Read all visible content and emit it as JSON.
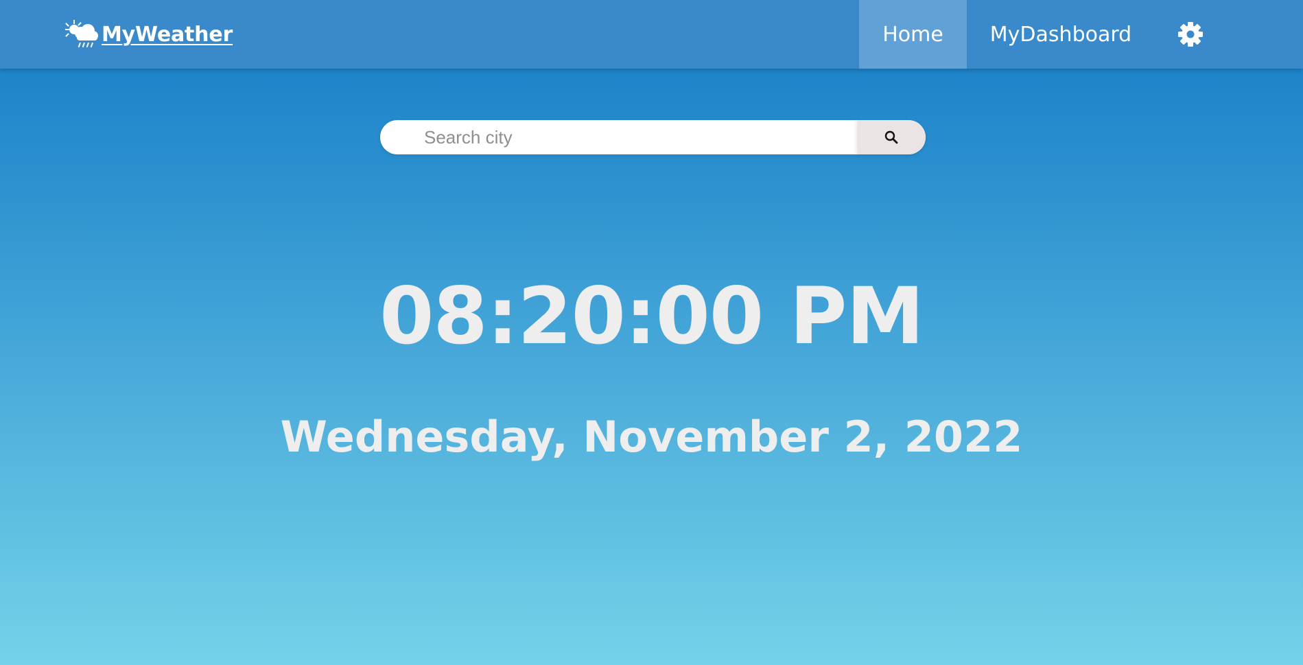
{
  "header": {
    "brand_name": "MyWeather",
    "brand_icon": "weather-sun-cloud-rain-icon",
    "nav_items": [
      {
        "label": "Home",
        "active": true
      },
      {
        "label": "MyDashboard",
        "active": false
      }
    ],
    "settings_icon": "gear-icon"
  },
  "search": {
    "placeholder": "Search city",
    "value": "",
    "button_icon": "search-icon"
  },
  "main": {
    "time": "08:20:00 PM",
    "date": "Wednesday, November 2, 2022"
  },
  "colors": {
    "navbar": "#3a8acb",
    "background_top": "#157dc7",
    "background_bottom": "#73d3e9",
    "active_nav": "rgba(255,255,255,0.2)",
    "search_button": "#ebe4e4",
    "display_text": "#eeeeee"
  }
}
